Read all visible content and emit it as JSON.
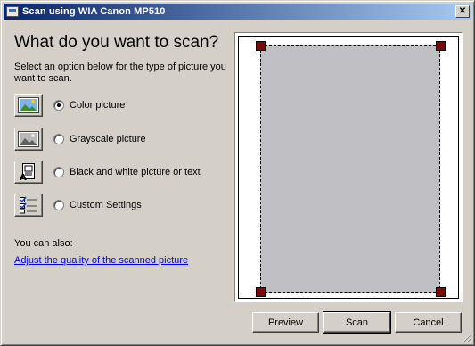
{
  "window": {
    "title": "Scan using WIA Canon MP510",
    "close_label": "✕"
  },
  "heading": "What do you want to scan?",
  "instructions": "Select an option below for the type of picture you want to scan.",
  "options": [
    {
      "label": "Color picture",
      "icon": "color-photo-icon",
      "selected": true
    },
    {
      "label": "Grayscale picture",
      "icon": "grayscale-photo-icon",
      "selected": false
    },
    {
      "label": "Black and white picture or text",
      "icon": "black-white-document-icon",
      "selected": false
    },
    {
      "label": "Custom Settings",
      "icon": "custom-settings-icon",
      "selected": false
    }
  ],
  "also": {
    "label": "You can also:",
    "link": "Adjust the quality of the scanned picture"
  },
  "buttons": {
    "preview": "Preview",
    "scan": "Scan",
    "cancel": "Cancel"
  },
  "colors": {
    "titlebar_start": "#0a246a",
    "titlebar_end": "#a6caf0",
    "link": "#0000ee",
    "scan_area": "#c0bfc4",
    "handle": "#7a0a0a"
  }
}
